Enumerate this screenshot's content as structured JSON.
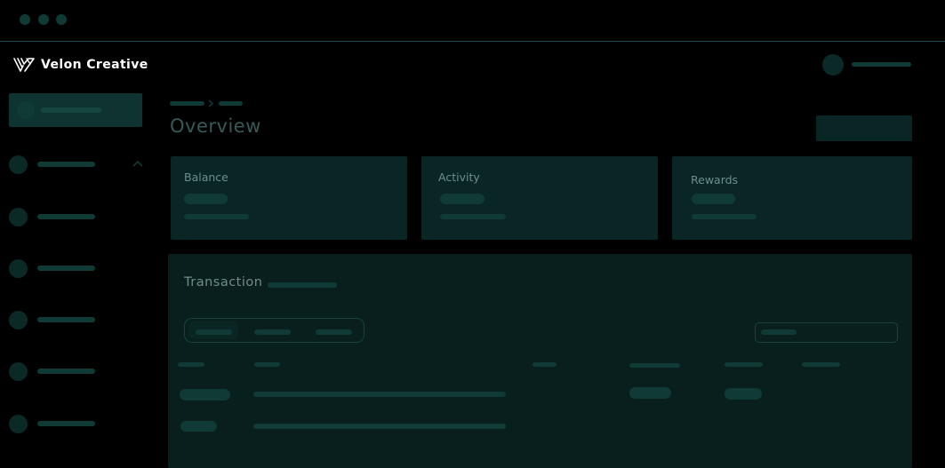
{
  "window": {
    "traffic_lights": [
      "close",
      "minimize",
      "maximize"
    ]
  },
  "brand": {
    "name": "Velon Creative",
    "logo_icon": "velon-logo-icon"
  },
  "header": {
    "avatar_icon": "user-avatar"
  },
  "sidebar": {
    "active_item": 0,
    "expanded_item_chevron": "chevron-up-icon",
    "item_count": 6
  },
  "main": {
    "page_title": "Overview",
    "cards": [
      {
        "label": "Balance"
      },
      {
        "label": "Activity"
      },
      {
        "label": "Rewards"
      }
    ],
    "transaction": {
      "title": "Transaction",
      "tab_count": 3,
      "active_tab": 0,
      "column_count": 6,
      "row_count": 2
    }
  },
  "colors": {
    "background": "#000000",
    "accent": "#0f3a36",
    "panel": "#0a2624",
    "brand_text": "#ffffff",
    "muted_text": "#6f8d8b"
  }
}
